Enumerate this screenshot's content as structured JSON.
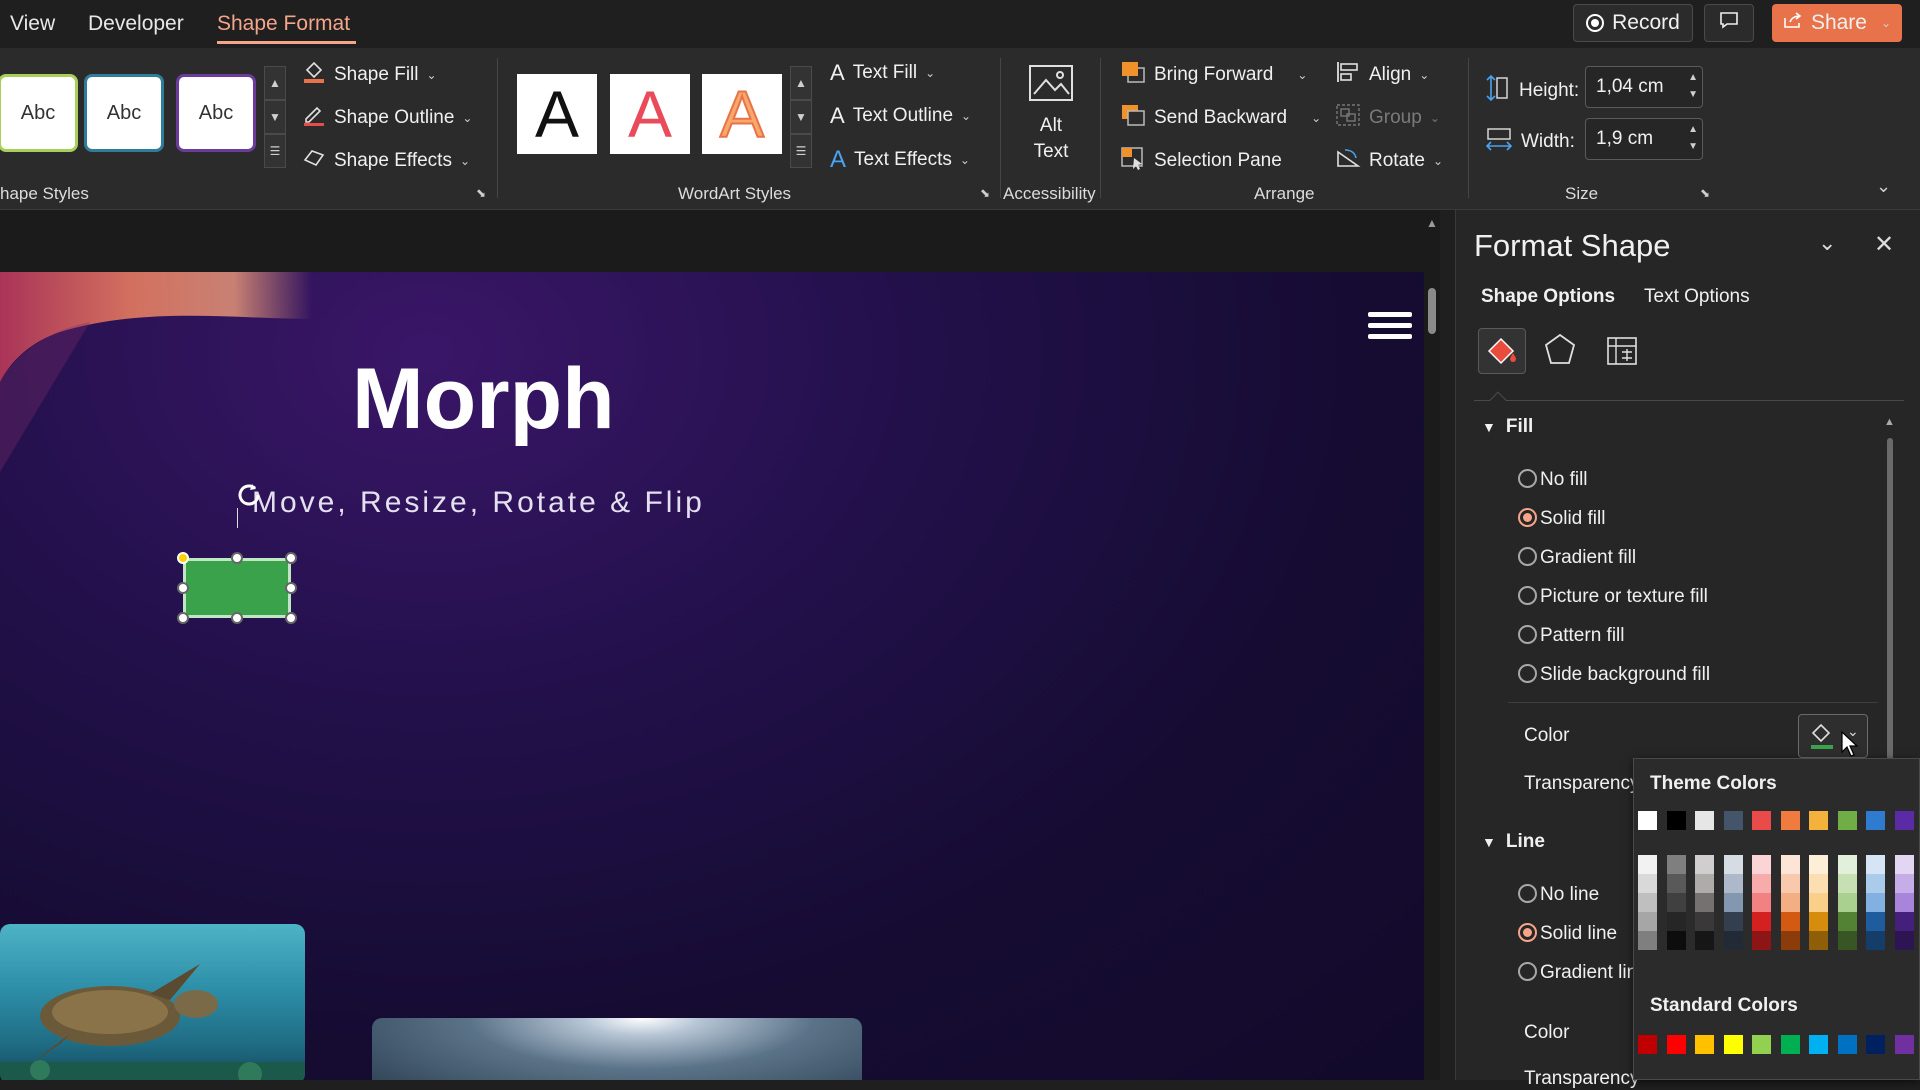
{
  "menubar": {
    "tabs": [
      "View",
      "Developer",
      "Shape Format"
    ],
    "record_label": "Record",
    "share_label": "Share"
  },
  "ribbon": {
    "shape_styles": {
      "samples": [
        "Abc",
        "Abc",
        "Abc"
      ],
      "group_label": "hape Styles",
      "fill": "Shape Fill",
      "outline": "Shape Outline",
      "effects": "Shape Effects"
    },
    "wordart": {
      "samples": [
        "A",
        "A",
        "A"
      ],
      "group_label": "WordArt Styles",
      "text_fill": "Text Fill",
      "text_outline": "Text Outline",
      "text_effects": "Text Effects"
    },
    "accessibility": {
      "alt_text_line1": "Alt",
      "alt_text_line2": "Text",
      "group_label": "Accessibility"
    },
    "arrange": {
      "bring_forward": "Bring Forward",
      "send_backward": "Send Backward",
      "selection_pane": "Selection Pane",
      "align": "Align",
      "group": "Group",
      "rotate": "Rotate",
      "group_label": "Arrange"
    },
    "size": {
      "height_label": "Height:",
      "height_value": "1,04 cm",
      "width_label": "Width:",
      "width_value": "1,9 cm",
      "group_label": "Size"
    }
  },
  "slide": {
    "title": "Morph",
    "subtitle": "Move, Resize, Rotate & Flip",
    "shape_color": "#3aa24a"
  },
  "pane": {
    "title": "Format Shape",
    "tab_shape_options": "Shape Options",
    "tab_text_options": "Text Options",
    "fill_section": "Fill",
    "fill_options": [
      {
        "label": "No fill",
        "checked": false
      },
      {
        "label": "Solid fill",
        "checked": true
      },
      {
        "label": "Gradient fill",
        "checked": false
      },
      {
        "label": "Picture or texture fill",
        "checked": false
      },
      {
        "label": "Pattern fill",
        "checked": false
      },
      {
        "label": "Slide background fill",
        "checked": false
      }
    ],
    "color_label": "Color",
    "transparency_label": "Transparency",
    "line_section": "Line",
    "line_options": [
      {
        "label": "No line",
        "checked": false
      },
      {
        "label": "Solid line",
        "checked": true
      },
      {
        "label": "Gradient line",
        "checked": false
      }
    ],
    "line_color_label": "Color",
    "line_transparency_label": "Transparency"
  },
  "color_popup": {
    "theme_title": "Theme Colors",
    "standard_title": "Standard Colors",
    "theme_top": [
      "#ffffff",
      "#000000",
      "#e7e6e6",
      "#44546a",
      "#e94b4b",
      "#f07b3f",
      "#f4b13b",
      "#70ad47",
      "#2e7bcf",
      "#5b2aa6"
    ],
    "theme_columns": [
      [
        "#f2f2f2",
        "#d9d9d9",
        "#bfbfbf",
        "#a6a6a6",
        "#7f7f7f"
      ],
      [
        "#7f7f7f",
        "#595959",
        "#404040",
        "#262626",
        "#0d0d0d"
      ],
      [
        "#d0cece",
        "#aeabab",
        "#757171",
        "#3a3838",
        "#171616"
      ],
      [
        "#d6dce4",
        "#adb9ca",
        "#8497b0",
        "#333f4f",
        "#222a35"
      ],
      [
        "#fbd5d5",
        "#f7abab",
        "#f28282",
        "#d52020",
        "#8e1515"
      ],
      [
        "#fce4d6",
        "#f8c9ad",
        "#f4ae84",
        "#d35a11",
        "#8c3c0b"
      ],
      [
        "#fdefd7",
        "#fbdfb0",
        "#f9cf89",
        "#d68d0d",
        "#8f5e09"
      ],
      [
        "#e2efda",
        "#c6e0b4",
        "#a9d08e",
        "#548235",
        "#375623"
      ],
      [
        "#d5e5f5",
        "#abcbeb",
        "#82b1e1",
        "#1f5c9e",
        "#143d69"
      ],
      [
        "#e2d6f3",
        "#c5ade7",
        "#a885db",
        "#441f7c",
        "#2d1452"
      ]
    ],
    "standard": [
      "#c00000",
      "#ff0000",
      "#ffc000",
      "#ffff00",
      "#92d050",
      "#00b050",
      "#00b0f0",
      "#0070c0",
      "#002060",
      "#7030a0"
    ]
  }
}
